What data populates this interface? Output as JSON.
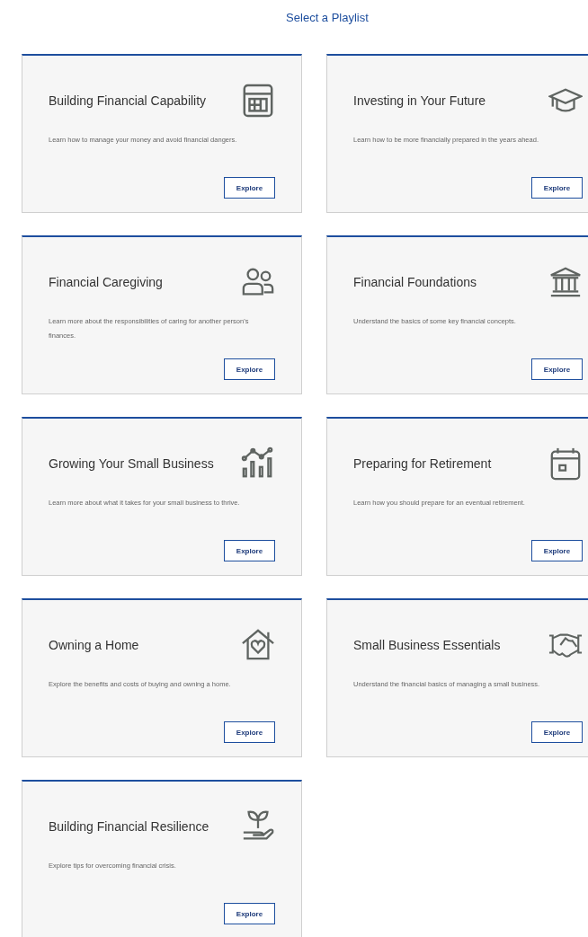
{
  "heading": "Select a Playlist",
  "playlists": [
    {
      "title": "Building Financial Capability",
      "description": "Learn how to manage your money and avoid financial dangers.",
      "button": "Explore"
    },
    {
      "title": "Investing in Your Future",
      "description": "Learn how to be more financially prepared in the years ahead.",
      "button": "Explore"
    },
    {
      "title": "Financial Caregiving",
      "description": "Learn more about the responsibilities of caring for another person's finances.",
      "button": "Explore"
    },
    {
      "title": "Financial Foundations",
      "description": "Understand the basics of some key financial concepts.",
      "button": "Explore"
    },
    {
      "title": "Growing Your Small Business",
      "description": "Learn more about what it takes for your small business to thrive.",
      "button": "Explore"
    },
    {
      "title": "Preparing for Retirement",
      "description": "Learn how you should prepare for an eventual retirement.",
      "button": "Explore"
    },
    {
      "title": "Owning a Home",
      "description": "Explore the benefits and costs of buying and owning a home.",
      "button": "Explore"
    },
    {
      "title": "Small Business Essentials",
      "description": "Understand the financial basics of managing a small business.",
      "button": "Explore"
    },
    {
      "title": "Building Financial Resilience",
      "description": "Explore tips for overcoming financial crisis.",
      "button": "Explore"
    }
  ]
}
